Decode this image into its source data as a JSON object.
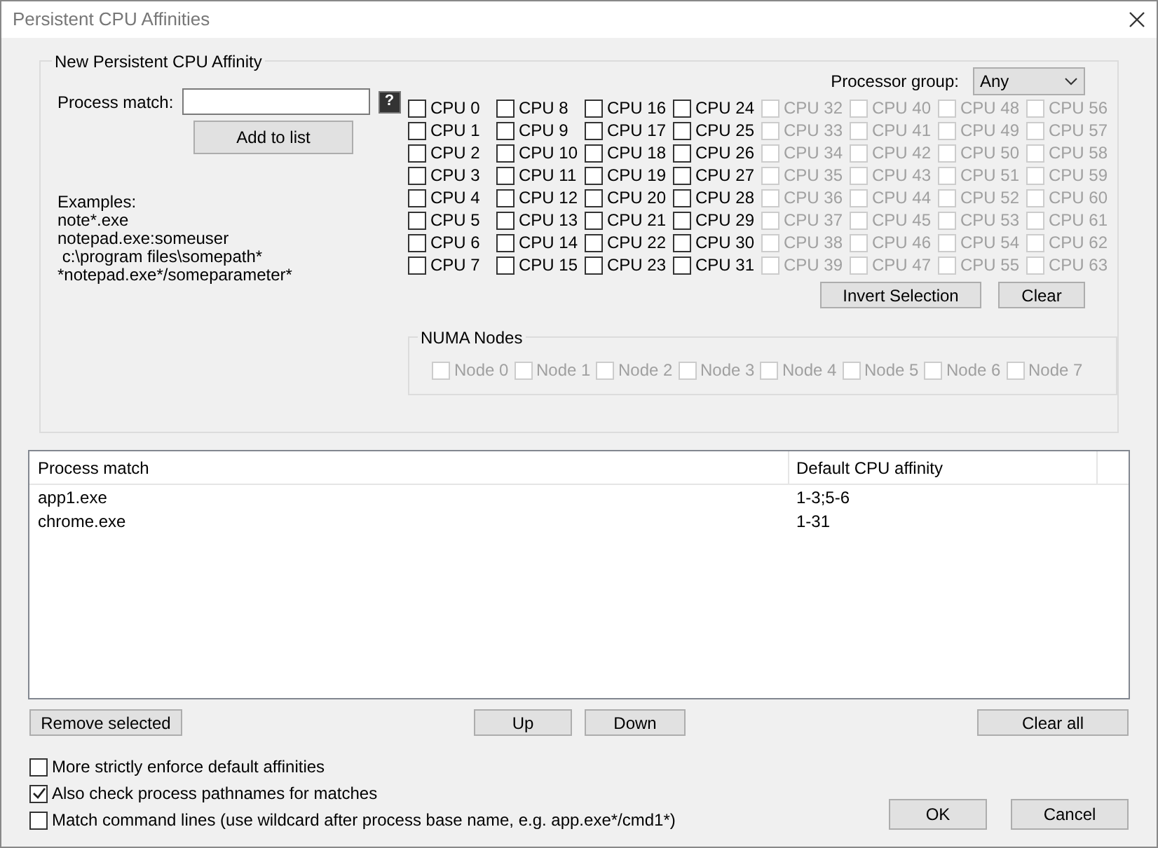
{
  "window": {
    "title": "Persistent CPU Affinities"
  },
  "new_affinity": {
    "title": "New Persistent CPU Affinity",
    "process_match_label": "Process match:",
    "help": "?",
    "add_button": "Add to list",
    "examples": [
      "Examples:",
      "note*.exe",
      "notepad.exe:someuser",
      " c:\\program files\\somepath*",
      "*notepad.exe*/someparameter*"
    ],
    "processor_group_label": "Processor group:",
    "processor_group_value": "Any",
    "cpus": [
      {
        "label": "CPU 0",
        "checked": false,
        "disabled": false
      },
      {
        "label": "CPU 1",
        "checked": false,
        "disabled": false
      },
      {
        "label": "CPU 2",
        "checked": false,
        "disabled": false
      },
      {
        "label": "CPU 3",
        "checked": false,
        "disabled": false
      },
      {
        "label": "CPU 4",
        "checked": false,
        "disabled": false
      },
      {
        "label": "CPU 5",
        "checked": false,
        "disabled": false
      },
      {
        "label": "CPU 6",
        "checked": false,
        "disabled": false
      },
      {
        "label": "CPU 7",
        "checked": false,
        "disabled": false
      },
      {
        "label": "CPU 8",
        "checked": false,
        "disabled": false
      },
      {
        "label": "CPU 9",
        "checked": false,
        "disabled": false
      },
      {
        "label": "CPU 10",
        "checked": false,
        "disabled": false
      },
      {
        "label": "CPU 11",
        "checked": false,
        "disabled": false
      },
      {
        "label": "CPU 12",
        "checked": false,
        "disabled": false
      },
      {
        "label": "CPU 13",
        "checked": false,
        "disabled": false
      },
      {
        "label": "CPU 14",
        "checked": false,
        "disabled": false
      },
      {
        "label": "CPU 15",
        "checked": false,
        "disabled": false
      },
      {
        "label": "CPU 16",
        "checked": false,
        "disabled": false
      },
      {
        "label": "CPU 17",
        "checked": false,
        "disabled": false
      },
      {
        "label": "CPU 18",
        "checked": false,
        "disabled": false
      },
      {
        "label": "CPU 19",
        "checked": false,
        "disabled": false
      },
      {
        "label": "CPU 20",
        "checked": false,
        "disabled": false
      },
      {
        "label": "CPU 21",
        "checked": false,
        "disabled": false
      },
      {
        "label": "CPU 22",
        "checked": false,
        "disabled": false
      },
      {
        "label": "CPU 23",
        "checked": false,
        "disabled": false
      },
      {
        "label": "CPU 24",
        "checked": false,
        "disabled": false
      },
      {
        "label": "CPU 25",
        "checked": false,
        "disabled": false
      },
      {
        "label": "CPU 26",
        "checked": false,
        "disabled": false
      },
      {
        "label": "CPU 27",
        "checked": false,
        "disabled": false
      },
      {
        "label": "CPU 28",
        "checked": false,
        "disabled": false
      },
      {
        "label": "CPU 29",
        "checked": false,
        "disabled": false
      },
      {
        "label": "CPU 30",
        "checked": false,
        "disabled": false
      },
      {
        "label": "CPU 31",
        "checked": false,
        "disabled": false
      },
      {
        "label": "CPU 32",
        "checked": false,
        "disabled": true
      },
      {
        "label": "CPU 33",
        "checked": false,
        "disabled": true
      },
      {
        "label": "CPU 34",
        "checked": false,
        "disabled": true
      },
      {
        "label": "CPU 35",
        "checked": false,
        "disabled": true
      },
      {
        "label": "CPU 36",
        "checked": false,
        "disabled": true
      },
      {
        "label": "CPU 37",
        "checked": false,
        "disabled": true
      },
      {
        "label": "CPU 38",
        "checked": false,
        "disabled": true
      },
      {
        "label": "CPU 39",
        "checked": false,
        "disabled": true
      },
      {
        "label": "CPU 40",
        "checked": false,
        "disabled": true
      },
      {
        "label": "CPU 41",
        "checked": false,
        "disabled": true
      },
      {
        "label": "CPU 42",
        "checked": false,
        "disabled": true
      },
      {
        "label": "CPU 43",
        "checked": false,
        "disabled": true
      },
      {
        "label": "CPU 44",
        "checked": false,
        "disabled": true
      },
      {
        "label": "CPU 45",
        "checked": false,
        "disabled": true
      },
      {
        "label": "CPU 46",
        "checked": false,
        "disabled": true
      },
      {
        "label": "CPU 47",
        "checked": false,
        "disabled": true
      },
      {
        "label": "CPU 48",
        "checked": false,
        "disabled": true
      },
      {
        "label": "CPU 49",
        "checked": false,
        "disabled": true
      },
      {
        "label": "CPU 50",
        "checked": false,
        "disabled": true
      },
      {
        "label": "CPU 51",
        "checked": false,
        "disabled": true
      },
      {
        "label": "CPU 52",
        "checked": false,
        "disabled": true
      },
      {
        "label": "CPU 53",
        "checked": false,
        "disabled": true
      },
      {
        "label": "CPU 54",
        "checked": false,
        "disabled": true
      },
      {
        "label": "CPU 55",
        "checked": false,
        "disabled": true
      },
      {
        "label": "CPU 56",
        "checked": false,
        "disabled": true
      },
      {
        "label": "CPU 57",
        "checked": false,
        "disabled": true
      },
      {
        "label": "CPU 58",
        "checked": false,
        "disabled": true
      },
      {
        "label": "CPU 59",
        "checked": false,
        "disabled": true
      },
      {
        "label": "CPU 60",
        "checked": false,
        "disabled": true
      },
      {
        "label": "CPU 61",
        "checked": false,
        "disabled": true
      },
      {
        "label": "CPU 62",
        "checked": false,
        "disabled": true
      },
      {
        "label": "CPU 63",
        "checked": false,
        "disabled": true
      }
    ],
    "invert_button": "Invert Selection",
    "clear_button": "Clear",
    "numa": {
      "title": "NUMA Nodes",
      "nodes": [
        {
          "label": "Node 0",
          "checked": false,
          "disabled": true
        },
        {
          "label": "Node 1",
          "checked": false,
          "disabled": true
        },
        {
          "label": "Node 2",
          "checked": false,
          "disabled": true
        },
        {
          "label": "Node 3",
          "checked": false,
          "disabled": true
        },
        {
          "label": "Node 4",
          "checked": false,
          "disabled": true
        },
        {
          "label": "Node 5",
          "checked": false,
          "disabled": true
        },
        {
          "label": "Node 6",
          "checked": false,
          "disabled": true
        },
        {
          "label": "Node 7",
          "checked": false,
          "disabled": true
        }
      ]
    }
  },
  "table": {
    "columns": [
      "Process match",
      "Default CPU affinity"
    ],
    "rows": [
      {
        "cells": [
          "app1.exe",
          "1-3;5-6"
        ],
        "selected": false
      },
      {
        "cells": [
          "chrome.exe",
          "1-31"
        ],
        "selected": false
      }
    ]
  },
  "list_buttons": {
    "remove": "Remove selected",
    "up": "Up",
    "down": "Down",
    "clear_all": "Clear all"
  },
  "options": [
    {
      "label": "More strictly enforce default affinities",
      "checked": false
    },
    {
      "label": "Also check process pathnames for matches",
      "checked": true
    },
    {
      "label": "Match command lines (use wildcard after process base name, e.g. app.exe*/cmd1*)",
      "checked": false
    }
  ],
  "dialog_buttons": [
    "OK",
    "Cancel"
  ]
}
